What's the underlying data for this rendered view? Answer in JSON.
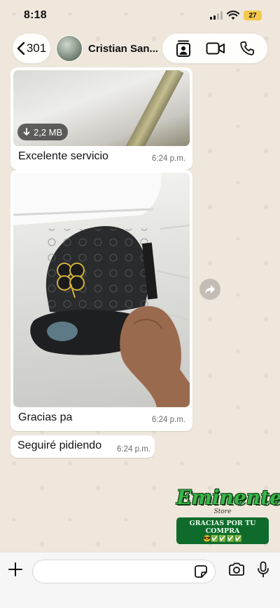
{
  "status": {
    "time": "8:18",
    "battery": "27"
  },
  "header": {
    "back_count": "301",
    "contact_name": "Cristian San..."
  },
  "messages": [
    {
      "caption": "Excelente servicio",
      "time": "6:24 p.m.",
      "file_size": "2,2 MB"
    },
    {
      "caption": "Gracias pa",
      "time": "6:24 p.m."
    },
    {
      "text": "Seguiré pidiendo",
      "time": "6:24 p.m."
    }
  ],
  "sticker": {
    "brand": "Eminente",
    "sub": "Store",
    "banner": "GRACIAS POR TU COMPRA",
    "emojis": "😎✅✅✅✅"
  },
  "composer": {
    "placeholder": ""
  },
  "colors": {
    "accent": "#25d366",
    "bubble": "#ffffff",
    "battery": "#f2c94c",
    "sticker_green": "#39b54a"
  }
}
